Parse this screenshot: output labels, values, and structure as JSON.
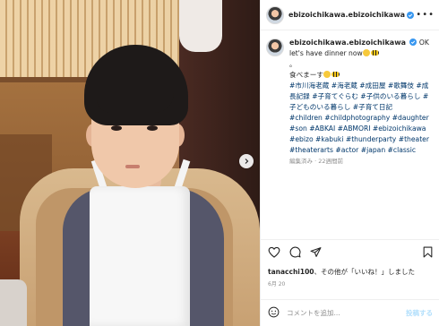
{
  "post": {
    "username": "ebizoichikawa.ebizoichikawa",
    "caption": {
      "line1": "OK",
      "line2": "let's have dinner now",
      "dot": "。",
      "line3": "食べまーす",
      "tags_jp": "#市川海老蔵 #海老蔵 #成田屋 #歌舞伎 #成長記録 #子育てぐらむ #子供のいる暮らし #子どものいる暮らし #子育て日記",
      "tags_en": "#children #childphotography #daughter #son #ABKAI #ABMORI #ebizoichikawa #ebizo #kabuki #thunderparty #theater #theaterarts #actor #japan #classic"
    },
    "edited_time": "編集済み · 22週間前",
    "likes_user": "tanacchi100",
    "likes_text": "、その他が「いいね！」しました",
    "date": "6月 20"
  },
  "comment": {
    "placeholder": "コメントを追加...",
    "post_label": "投稿する"
  },
  "colors": {
    "verified": "#3897f0",
    "hashtag": "#00376b",
    "muted": "#8e8e8e"
  }
}
